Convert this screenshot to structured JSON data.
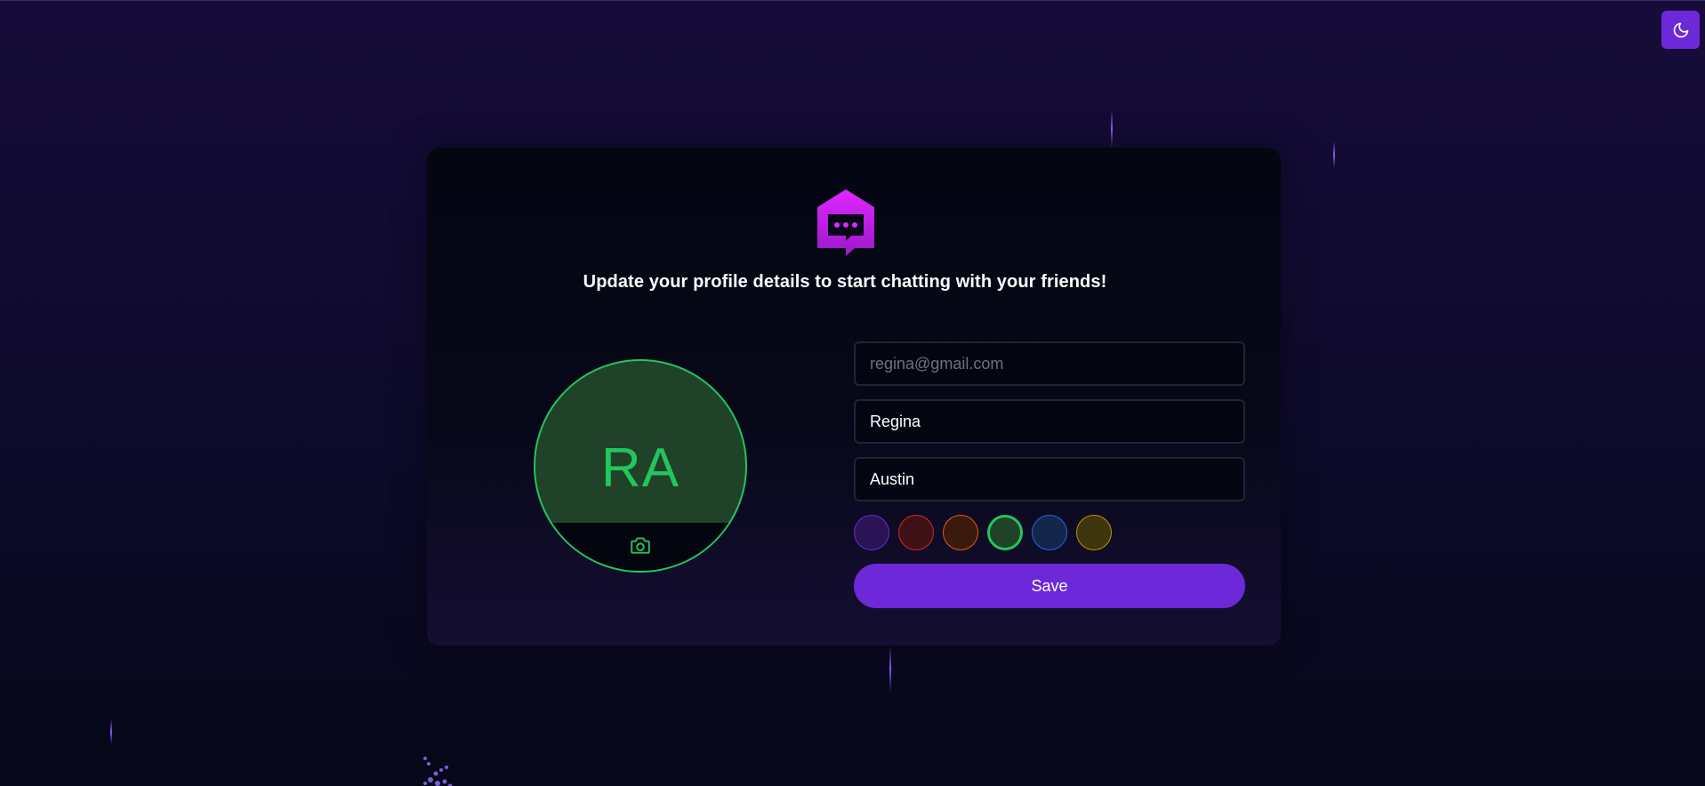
{
  "header": {
    "theme_toggle_icon": "moon-icon"
  },
  "card": {
    "logo_icon": "chat-house-logo",
    "headline": "Update your profile details to start chatting with your friends!"
  },
  "avatar": {
    "initials": "RA",
    "selected_color": "#22c55e",
    "upload_icon": "camera-icon"
  },
  "form": {
    "email_value": "",
    "email_placeholder": "regina@gmail.com",
    "first_name_value": "Regina",
    "last_name_value": "Austin",
    "colors": [
      {
        "name": "purple",
        "fill": "#2a1456",
        "border": "#6d28d9"
      },
      {
        "name": "red",
        "fill": "#3d1116",
        "border": "#dc2626"
      },
      {
        "name": "orange",
        "fill": "#3a1a0d",
        "border": "#ea580c"
      },
      {
        "name": "green",
        "fill": "#1f4229",
        "border": "#22c55e",
        "selected": true
      },
      {
        "name": "blue",
        "fill": "#142649",
        "border": "#2563eb"
      },
      {
        "name": "yellow",
        "fill": "#3e360d",
        "border": "#ca8a04"
      }
    ],
    "save_label": "Save"
  }
}
